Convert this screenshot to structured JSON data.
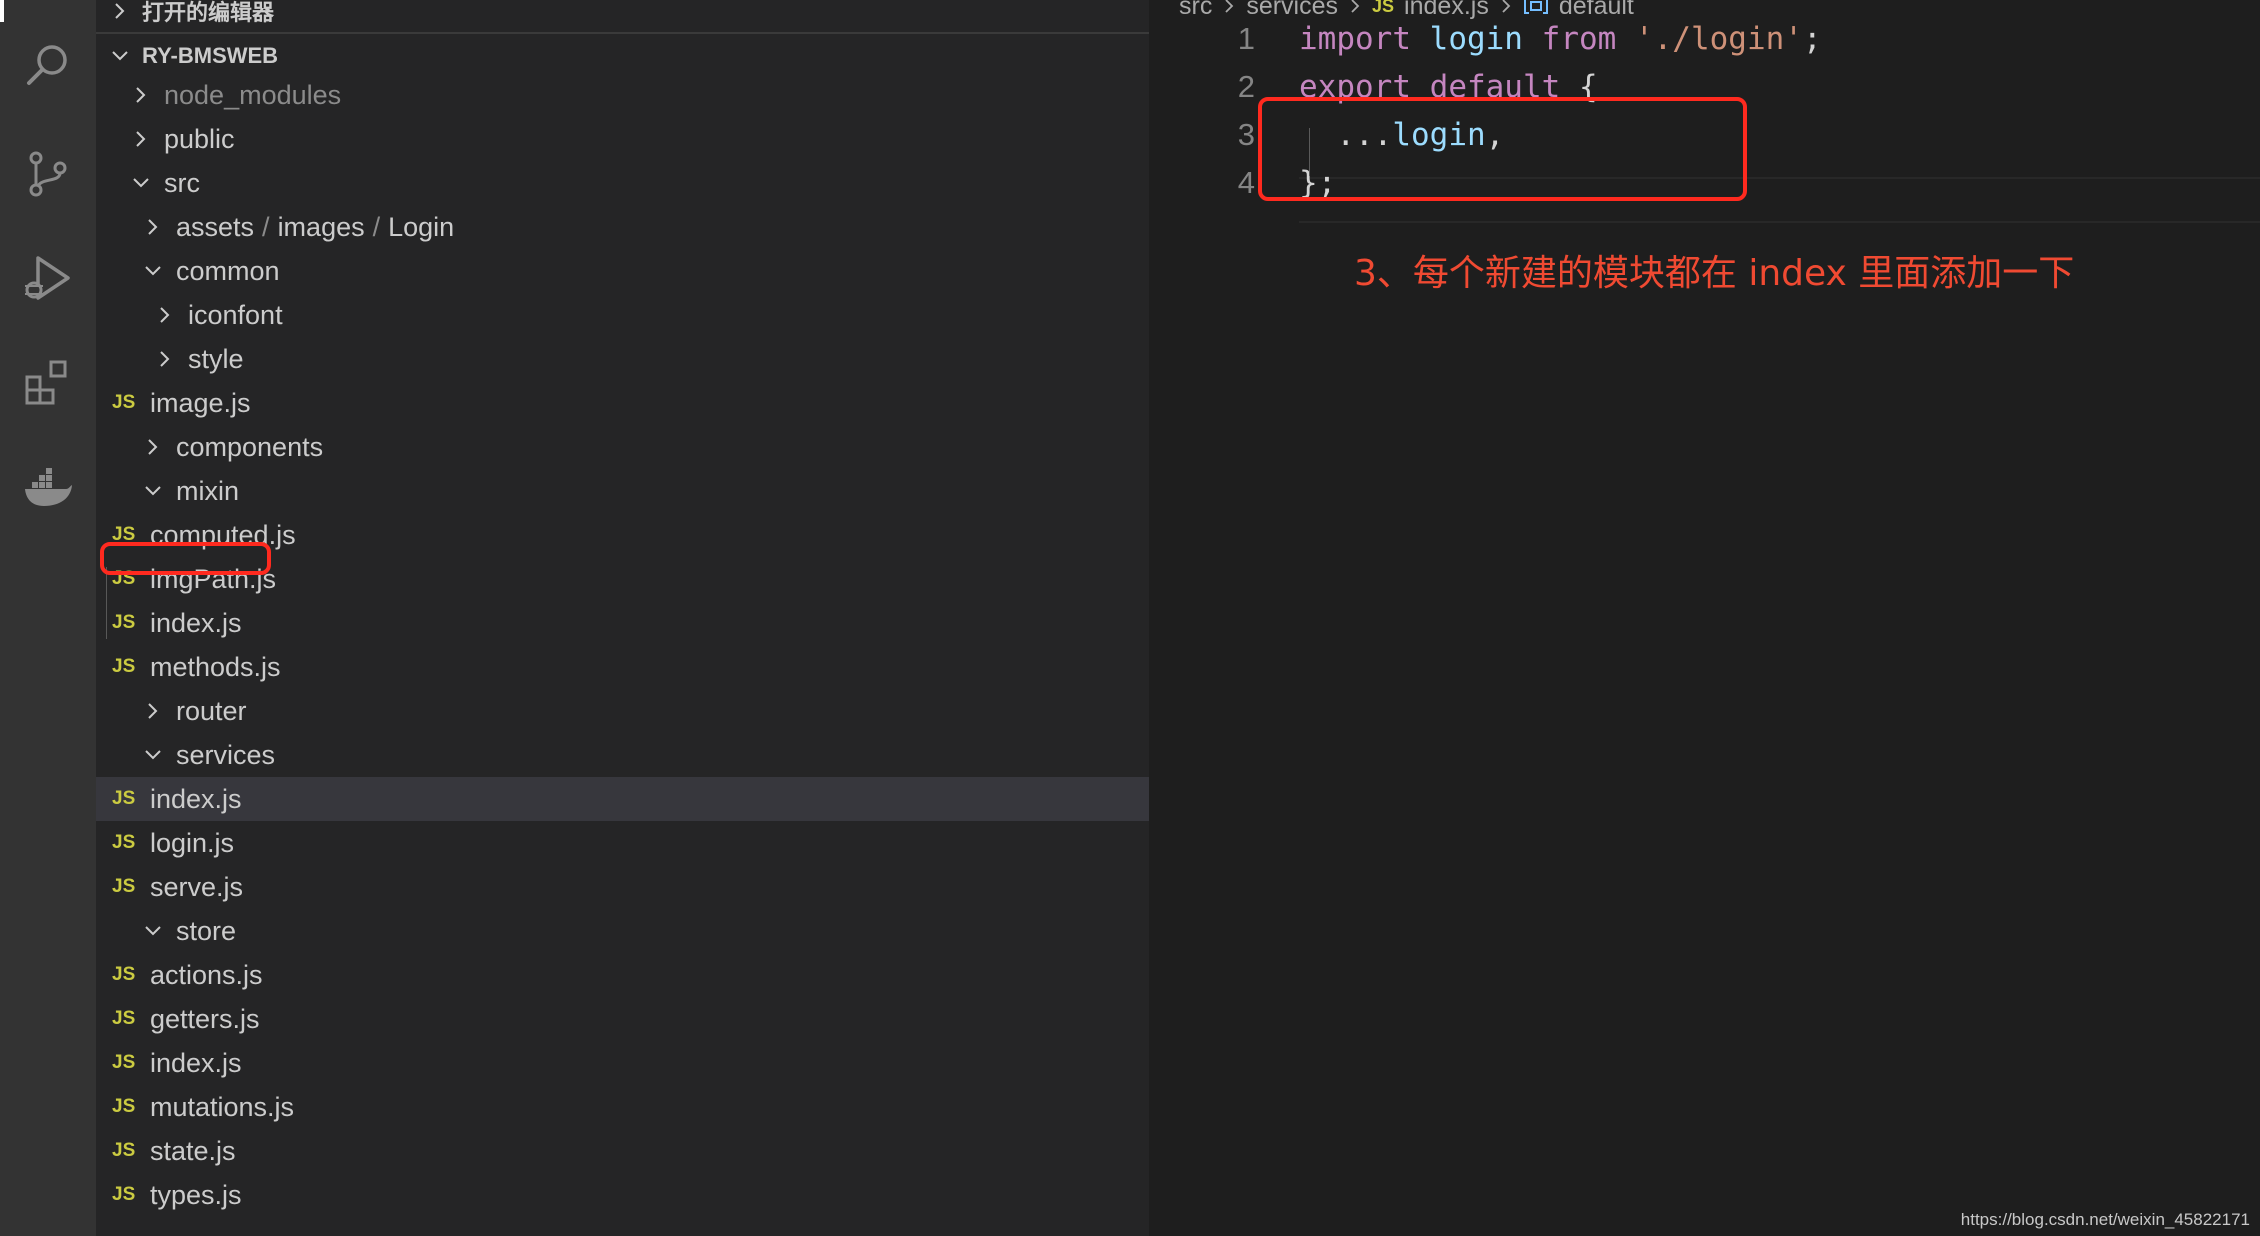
{
  "explorer": {
    "open_editors_label": "打开的编辑器",
    "root_label": "RY-BMSWEB",
    "tree": [
      {
        "label": "node_modules",
        "type": "folder",
        "expanded": false,
        "dim": true
      },
      {
        "label": "public",
        "type": "folder",
        "expanded": false
      },
      {
        "label": "src",
        "type": "folder",
        "expanded": true
      },
      {
        "path": [
          "assets",
          "images",
          "Login"
        ],
        "type": "folder",
        "expanded": false
      },
      {
        "label": "common",
        "type": "folder",
        "expanded": true
      },
      {
        "label": "iconfont",
        "type": "folder",
        "expanded": false
      },
      {
        "label": "style",
        "type": "folder",
        "expanded": false
      },
      {
        "label": "image.js",
        "type": "js"
      },
      {
        "label": "components",
        "type": "folder",
        "expanded": false
      },
      {
        "label": "mixin",
        "type": "folder",
        "expanded": true
      },
      {
        "label": "computed.js",
        "type": "js"
      },
      {
        "label": "imgPath.js",
        "type": "js"
      },
      {
        "label": "index.js",
        "type": "js"
      },
      {
        "label": "methods.js",
        "type": "js"
      },
      {
        "label": "router",
        "type": "folder",
        "expanded": false
      },
      {
        "label": "services",
        "type": "folder",
        "expanded": true
      },
      {
        "label": "index.js",
        "type": "js",
        "selected": true
      },
      {
        "label": "login.js",
        "type": "js"
      },
      {
        "label": "serve.js",
        "type": "js"
      },
      {
        "label": "store",
        "type": "folder",
        "expanded": true
      },
      {
        "label": "actions.js",
        "type": "js"
      },
      {
        "label": "getters.js",
        "type": "js"
      },
      {
        "label": "index.js",
        "type": "js"
      },
      {
        "label": "mutations.js",
        "type": "js"
      },
      {
        "label": "state.js",
        "type": "js"
      },
      {
        "label": "types.js",
        "type": "js"
      }
    ],
    "path_separator": "/",
    "js_badge": "JS"
  },
  "breadcrumb": {
    "parts": [
      "src",
      "services",
      "index.js",
      "default"
    ]
  },
  "editor": {
    "lines": [
      {
        "number": "1",
        "tokens": [
          {
            "t": "import",
            "c": "kw"
          },
          {
            "t": " ",
            "c": "punc"
          },
          {
            "t": "login",
            "c": "id"
          },
          {
            "t": " ",
            "c": "punc"
          },
          {
            "t": "from",
            "c": "kw"
          },
          {
            "t": " ",
            "c": "punc"
          },
          {
            "t": "'./login'",
            "c": "str"
          },
          {
            "t": ";",
            "c": "punc"
          }
        ]
      },
      {
        "number": "2",
        "tokens": [
          {
            "t": "export",
            "c": "kw"
          },
          {
            "t": " ",
            "c": "punc"
          },
          {
            "t": "default",
            "c": "kw"
          },
          {
            "t": " ",
            "c": "punc"
          },
          {
            "t": "{",
            "c": "brace"
          }
        ]
      },
      {
        "number": "3",
        "tokens": [
          {
            "t": "  ...",
            "c": "punc"
          },
          {
            "t": "login",
            "c": "id"
          },
          {
            "t": ",",
            "c": "punc"
          }
        ]
      },
      {
        "number": "4",
        "tokens": [
          {
            "t": "};",
            "c": "punc"
          }
        ]
      }
    ]
  },
  "annotation": {
    "text": "3、每个新建的模块都在 index 里面添加一下"
  },
  "watermark": "https://blog.csdn.net/weixin_45822171",
  "colors": {
    "annotation_red": "#ff2a1f",
    "js_badge": "#cbcb41",
    "selection": "#37373d"
  }
}
